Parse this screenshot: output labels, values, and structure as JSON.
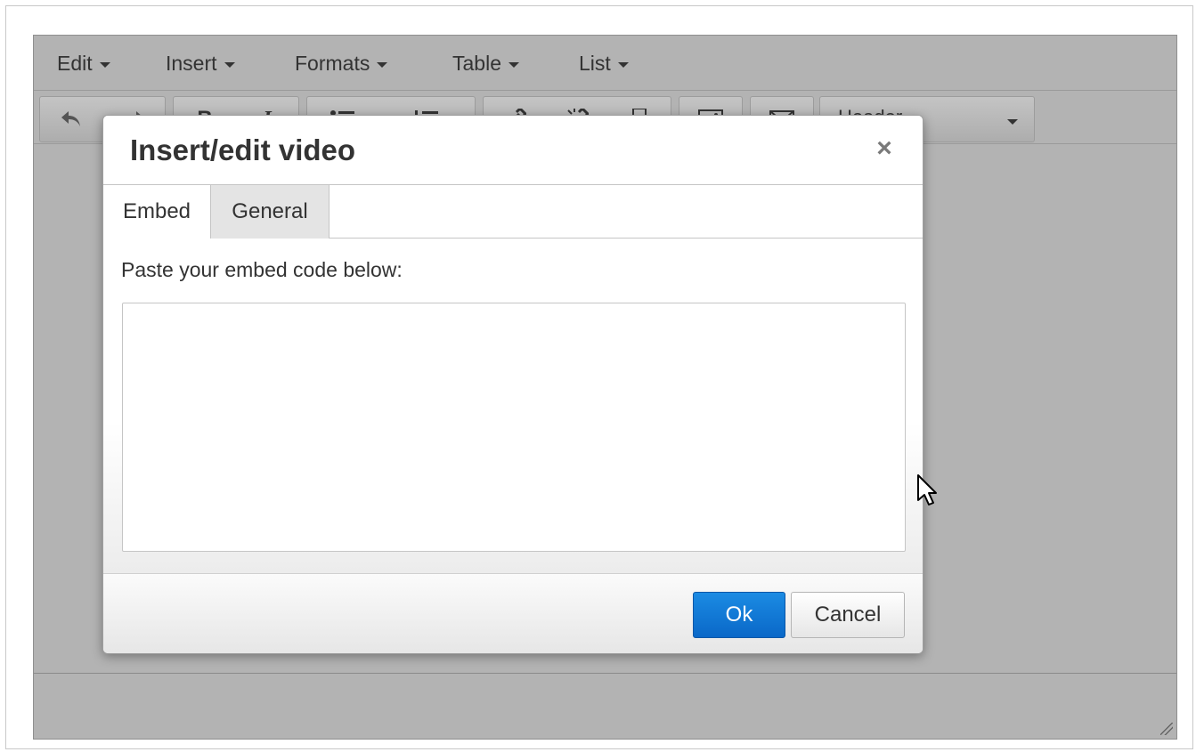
{
  "menubar": {
    "items": [
      {
        "label": "Edit"
      },
      {
        "label": "Insert"
      },
      {
        "label": "Formats"
      },
      {
        "label": "Table"
      },
      {
        "label": "List"
      }
    ]
  },
  "toolbar": {
    "bold_label": "B",
    "italic_label": "I",
    "block_format_value": "Header",
    "icons": [
      "undo-icon",
      "redo-icon",
      "bold-icon",
      "italic-icon",
      "bullet-list-icon",
      "numbered-list-icon",
      "link-icon",
      "unlink-icon",
      "bookmark-icon",
      "image-icon",
      "email-icon"
    ]
  },
  "dialog": {
    "title": "Insert/edit video",
    "close_symbol": "×",
    "tabs": [
      {
        "label": "Embed",
        "active": true
      },
      {
        "label": "General",
        "active": false
      }
    ],
    "embed_label": "Paste your embed code below:",
    "embed_value": "",
    "ok_label": "Ok",
    "cancel_label": "Cancel"
  },
  "colors": {
    "overlay_gray": "#b3b3b3",
    "primary_blue": "#0a68c8",
    "text": "#333333"
  }
}
